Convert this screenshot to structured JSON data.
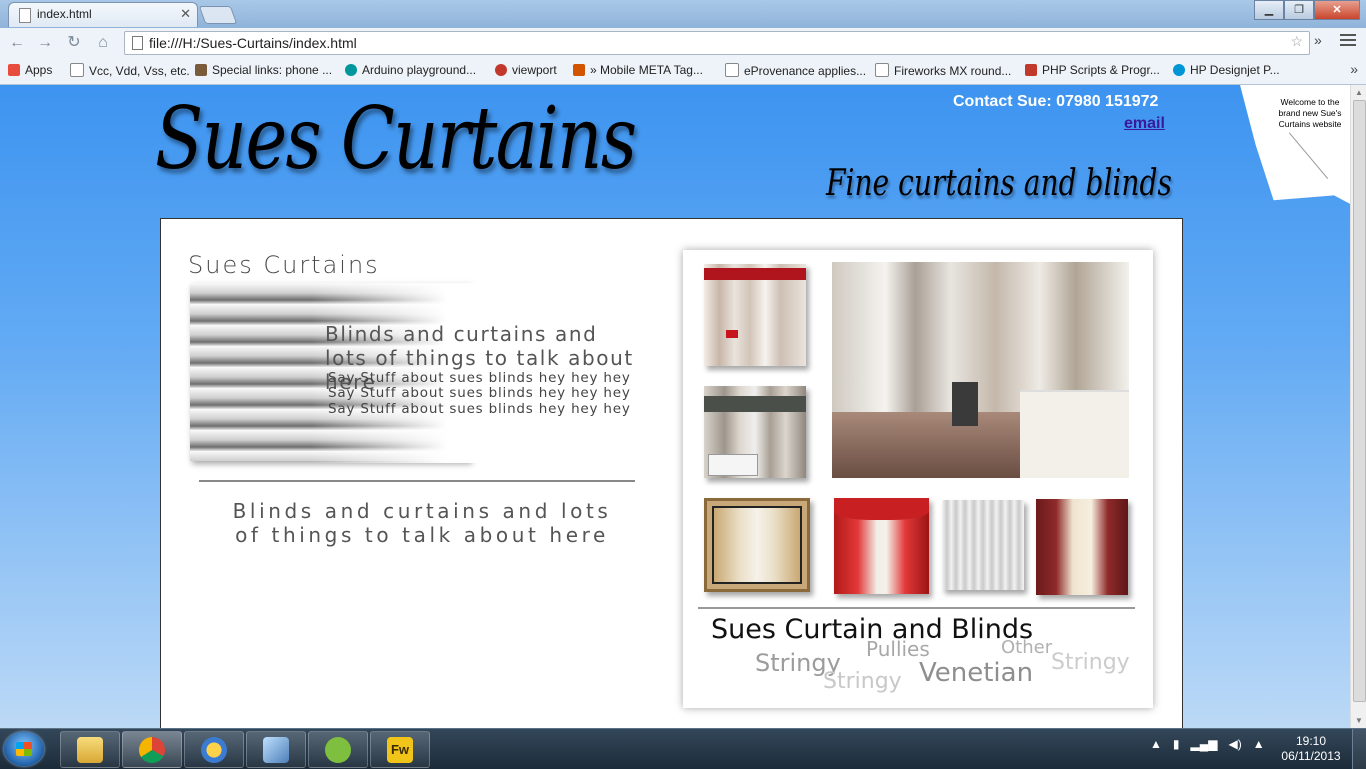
{
  "browser": {
    "tab_title": "index.html",
    "tab_close": "✕",
    "window_controls": {
      "minimize": "▁",
      "maximize": "❐",
      "close": "✕"
    },
    "nav": {
      "back": "←",
      "forward": "→",
      "reload": "↻",
      "home": "⌂"
    },
    "address": "file:///H:/Sues-Curtains/index.html",
    "star": "☆",
    "extensions": "»",
    "bookmarks": [
      {
        "label": "Apps",
        "color": "#e84c3d"
      },
      {
        "label": "Vcc, Vdd, Vss, etc.",
        "color": "#ffffff"
      },
      {
        "label": "Special links: phone ...",
        "color": "#7a5c3a"
      },
      {
        "label": "Arduino playground...",
        "color": "#00979c"
      },
      {
        "label": "viewport",
        "color": "#c0392b"
      },
      {
        "label": "» Mobile META Tag...",
        "color": "#d35400"
      },
      {
        "label": "eProvenance applies...",
        "color": "#ffffff"
      },
      {
        "label": "Fireworks MX round...",
        "color": "#ffffff"
      },
      {
        "label": "PHP Scripts & Progr...",
        "color": "#c0392b"
      },
      {
        "label": "HP Designjet P...",
        "color": "#0096d6"
      }
    ],
    "bookmarks_more": "»"
  },
  "page": {
    "contact": "Contact Sue: 07980 151972",
    "email_link": "email",
    "logo": "Sues Curtains",
    "tagline": "Fine curtains and blinds",
    "welcome_note": "Welcome to the brand new Sue's Curtains website",
    "left": {
      "title": "Sues Curtains",
      "hero_heading": "Blinds and curtains and lots of things to talk about here",
      "hero_lines": [
        "Say Stuff about sues blinds hey hey hey",
        "Say Stuff about sues blinds hey hey hey",
        "Say Stuff about sues blinds hey hey hey"
      ],
      "sub_heading": "Blinds and curtains and lots of things to talk about here"
    },
    "gallery": {
      "title": "Sues Curtain and Blinds",
      "tags": [
        "Stringy",
        "Pullies",
        "Other",
        "Stringy",
        "Stringy",
        "Venetian"
      ]
    }
  },
  "taskbar": {
    "apps": [
      "Windows Explorer",
      "Google Chrome",
      "Messenger",
      "VirtualBox",
      "Spotify",
      "Fireworks"
    ],
    "fw_label": "Fw",
    "tray_icons": [
      "▲",
      "▮",
      "▂▄▆",
      "◀)",
      "▲"
    ],
    "time": "19:10",
    "date": "06/11/2013"
  },
  "colors": {
    "page_gradient_top": "#3d94f0",
    "page_gradient_bottom": "#bcd9f6",
    "email_link": "#3a1a9a"
  }
}
